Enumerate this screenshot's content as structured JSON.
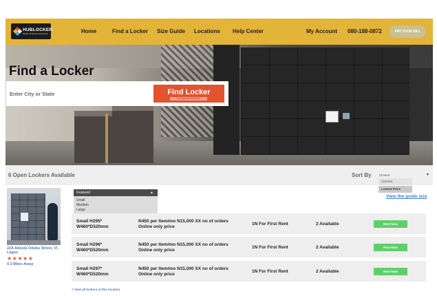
{
  "brand": {
    "name": "HUBLOCKER",
    "tagline": "SMART STORAGE SOLUTIONS",
    "diamond_colors": [
      "#e2532e",
      "#e4b439",
      "#ffffff",
      "#5fa8d3"
    ]
  },
  "nav": {
    "items": [
      "Home",
      "Find a Locker",
      "Size Guide",
      "Locations",
      "Help Center"
    ],
    "account": "My Account",
    "phone": "080-188-0872",
    "pay_button": "PAY YOUR BILL"
  },
  "hero": {
    "title": "Find a Locker",
    "search_placeholder": "Enter City or State",
    "find_button": "Find Locker",
    "find_button_sub": "Free Naira Per First Rent"
  },
  "results": {
    "count_text": "6 Open Lockers Available",
    "sort_label": "Sort By",
    "sort_selected": "Closest",
    "sort_options": [
      "Closest",
      "Lowest Price"
    ],
    "guide_link": "View the guide size"
  },
  "location": {
    "address": "22A Adeola Odeku Street, VI, Lagos",
    "stars": "★★★★★",
    "rating": 5,
    "distance": "0.3 Miles Away"
  },
  "size_filter": {
    "selected": "Featured",
    "options": [
      "Small",
      "Medium",
      "Large"
    ]
  },
  "lockers": [
    {
      "size_line1": "Small H295*",
      "size_line2": "W460*D520mm",
      "price_line1": "N450 per Item/mo N15,000 XX no of orders",
      "price_line2": "Online only price",
      "promo": "1N For First Rent",
      "available": "2 Available",
      "button": "Rent Now"
    },
    {
      "size_line1": "Small H296*",
      "size_line2": "W460*D520mm",
      "price_line1": "N450 per Item/mo N15,000 XX no of orders",
      "price_line2": "Online only price",
      "promo": "1N For First Rent",
      "available": "2 Available",
      "button": "Rent Now"
    },
    {
      "size_line1": "Small H297*",
      "size_line2": "W460*D520mm",
      "price_line1": "N450 per Item/mo N15,000 XX no of orders",
      "price_line2": "Online only price",
      "promo": "1N For First Rent",
      "available": "2 Available",
      "button": "Rent Now"
    }
  ],
  "view_all": "+ View all lockers at this location",
  "colors": {
    "nav_bg": "#e4b439",
    "accent": "#e2532e",
    "rent_button": "#5fcf6c",
    "link": "#4b79c4"
  }
}
